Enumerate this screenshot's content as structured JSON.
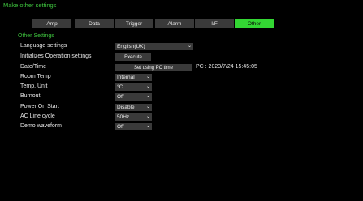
{
  "window_title": "Make other settings",
  "tabs": [
    {
      "label": "Amp"
    },
    {
      "label": "Data"
    },
    {
      "label": "Trigger"
    },
    {
      "label": "Alarm"
    },
    {
      "label": "I/F"
    },
    {
      "label": "Other",
      "active": true
    }
  ],
  "section_title": "Other Settings",
  "settings": {
    "language": {
      "label": "Language settings",
      "value": "English(UK)"
    },
    "init_ops": {
      "label": "Initializes Operation settings",
      "button": "Execute"
    },
    "datetime": {
      "label": "Date/Time",
      "button": "Set using PC time",
      "pc_time": "PC : 2023/7/24 15:45:05"
    },
    "room_temp": {
      "label": "Room Temp",
      "value": "Internal"
    },
    "temp_unit": {
      "label": "Temp. Unit",
      "value": "°C"
    },
    "burnout": {
      "label": "Burnout",
      "value": "Off"
    },
    "power_on_start": {
      "label": "Power On Start",
      "value": "Disable"
    },
    "ac_line_cycle": {
      "label": "AC Line cycle",
      "value": "50Hz"
    },
    "demo_waveform": {
      "label": "Demo waveform",
      "value": "Off"
    }
  },
  "icons": {
    "dropdown": "chevron-down-icon"
  },
  "colors": {
    "accent": "#33d633",
    "background": "#000000",
    "control": "#3a3a3a"
  }
}
